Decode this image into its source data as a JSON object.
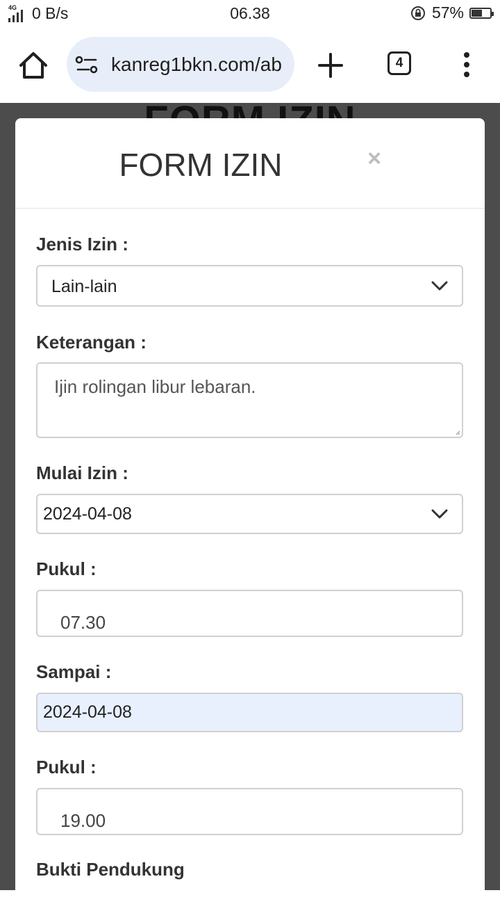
{
  "status_bar": {
    "network_type": "4G",
    "data_rate": "0 B/s",
    "time": "06.38",
    "battery_percent": "57%",
    "battery_level": 0.57
  },
  "browser": {
    "url": "kanreg1bkn.com/ab",
    "tab_count": "4",
    "icons": [
      "home-icon",
      "site-settings-icon",
      "new-tab-plus-icon",
      "tabs-counter-icon",
      "overflow-menu-icon"
    ]
  },
  "page": {
    "background_title": "FORM IZIN"
  },
  "modal": {
    "title": "FORM IZIN",
    "close_glyph": "×",
    "fields": {
      "jenis_izin": {
        "label": "Jenis Izin :",
        "value": "Lain-lain"
      },
      "keterangan": {
        "label": "Keterangan :",
        "value": "Ijin rolingan libur lebaran."
      },
      "mulai_izin": {
        "label": "Mulai Izin :",
        "value": "2024-04-08"
      },
      "pukul_mulai": {
        "label": "Pukul :",
        "value": "07.30"
      },
      "sampai": {
        "label": "Sampai :",
        "value": "2024-04-08"
      },
      "pukul_sampai": {
        "label": "Pukul :",
        "value": "19.00"
      },
      "bukti_pendukung": {
        "label": "Bukti Pendukung"
      }
    }
  },
  "colors": {
    "backdrop": "#4c4c4c",
    "url_bar": "#e8eef9",
    "autofill_field": "#e8f0fe",
    "label_text": "#333333"
  }
}
